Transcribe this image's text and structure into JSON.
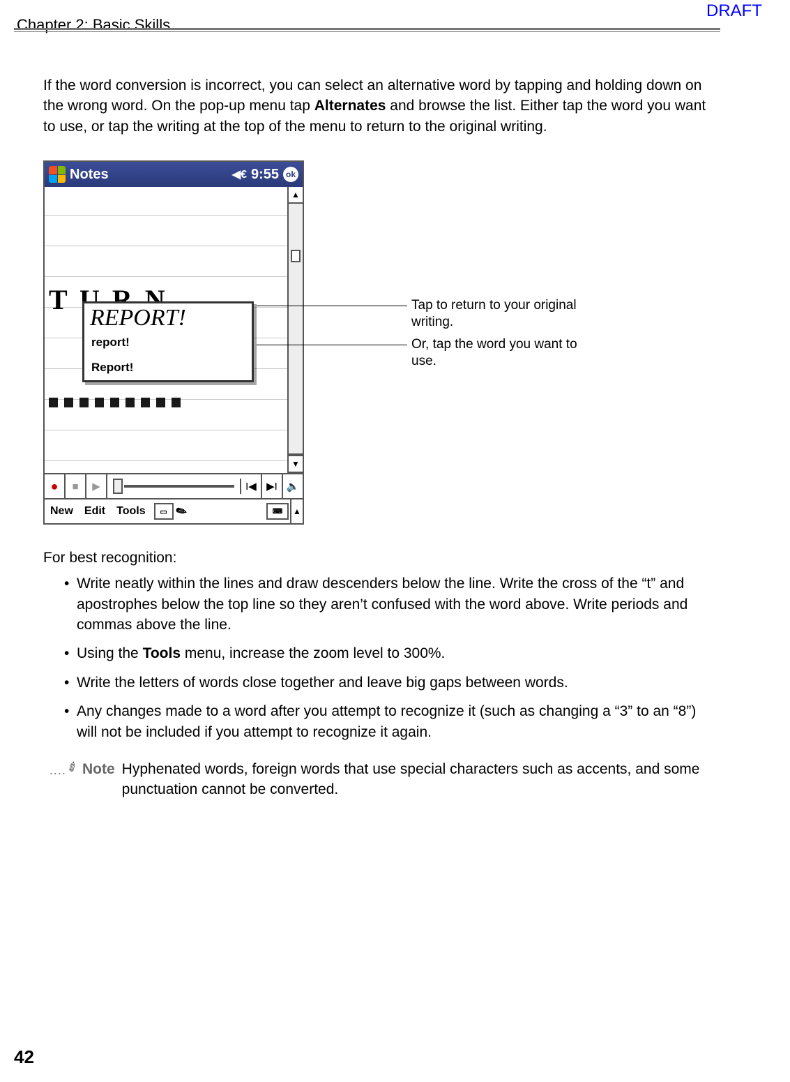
{
  "header": {
    "chapter": "Chapter 2: Basic Skills",
    "draft": "DRAFT"
  },
  "intro": {
    "p1a": "If the word conversion is incorrect, you can select an alternative word by tapping and holding down on the wrong word. On the pop-up menu tap ",
    "p1b": "Alternates",
    "p1c": " and browse the list.  Either tap the word you want to use, or tap the writing at the top of the menu to return to the original writing."
  },
  "device": {
    "app_title": "Notes",
    "time": "9:55",
    "ok": "ok",
    "background_handwriting": "T U R N",
    "popup_handwriting": "REPORT!",
    "alternates": {
      "a1": "report!",
      "a2": "Report!"
    },
    "menu": {
      "new": "New",
      "edit": "Edit",
      "tools": "Tools"
    }
  },
  "annotations": {
    "a1": "Tap to return to your original writing.",
    "a2": "Or, tap the word you want to use."
  },
  "tips": {
    "heading": "For best recognition:",
    "b1": "Write neatly within the lines and draw descenders below the line.  Write the cross of the “t” and apostrophes below the top line so they aren’t confused with the word above.  Write periods and commas above the line.",
    "b2a": "Using the ",
    "b2b": "Tools",
    "b2c": " menu, increase the zoom level to 300%.",
    "b3": "Write the letters of words close together and leave big gaps between words.",
    "b4": "Any changes made to a word after you attempt to recognize it (such as changing a “3” to an “8”) will not be included if you attempt to recognize it again."
  },
  "note": {
    "label": "Note",
    "text": "Hyphenated words, foreign words that use special characters such as accents, and some punctuation cannot be converted."
  },
  "page_number": "42"
}
